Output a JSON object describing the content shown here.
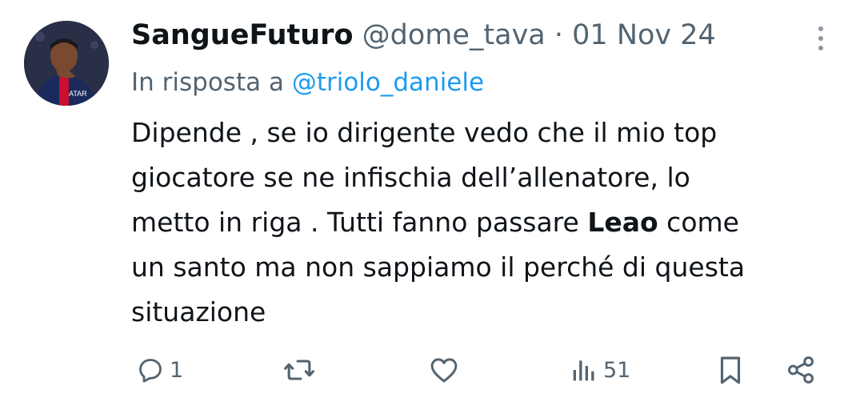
{
  "tweet": {
    "display_name": "SangueFuturo",
    "handle": "@dome_tava",
    "separator": "·",
    "date": "01 Nov 24",
    "reply_prefix": "In risposta a",
    "reply_mention": "@triolo_daniele",
    "body_line1": "Dipende , se io dirigente vedo che il mio top",
    "body_line2": "giocatore se ne infischia dell’allenatore, lo",
    "body_line3_a": "metto in riga . Tutti fanno passare ",
    "body_line3_bold": "Leao",
    "body_line3_b": " come",
    "body_line4": "un santo ma non sappiamo il perché di questa",
    "body_line5": "situazione"
  },
  "actions": {
    "reply_icon": "reply-icon",
    "reply_count": "1",
    "retweet_icon": "retweet-icon",
    "like_icon": "heart-icon",
    "views_icon": "views-icon",
    "views_count": "51",
    "bookmark_icon": "bookmark-icon",
    "share_icon": "share-icon"
  },
  "colors": {
    "text_primary": "#0f1419",
    "text_secondary": "#536471",
    "link": "#1d9bf0"
  }
}
